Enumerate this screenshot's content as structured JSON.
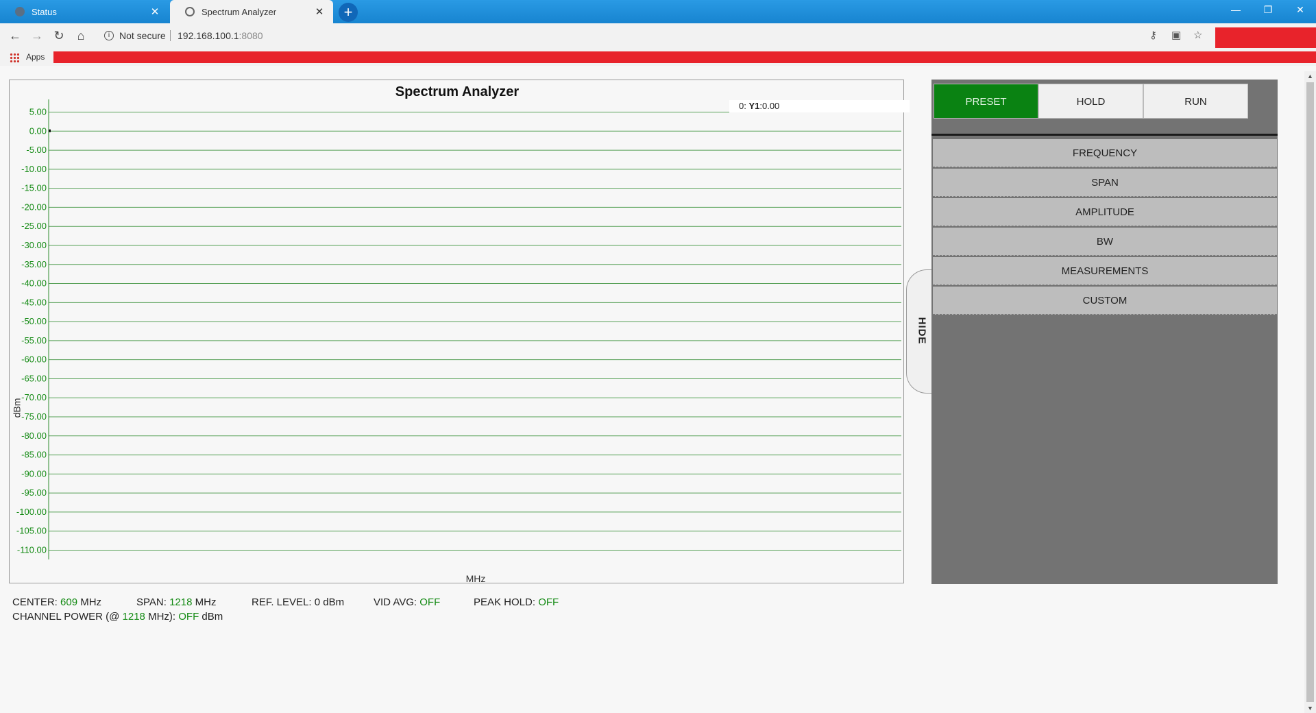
{
  "browser": {
    "tabs": [
      {
        "title": "Status",
        "active": false
      },
      {
        "title": "Spectrum Analyzer",
        "active": true
      }
    ],
    "new_tab_symbol": "+",
    "close_symbol": "✕",
    "window_controls": {
      "minimize": "—",
      "maximize": "❐",
      "close": "✕"
    },
    "security_label": "Not secure",
    "url_host": "192.168.100.1",
    "url_port": ":8080",
    "bookmarks": [
      {
        "label": "Apps",
        "icon": "apps-grid-icon"
      }
    ],
    "accent_red": "#e8232b"
  },
  "chart": {
    "title": "Spectrum Analyzer",
    "readout_index": "0: ",
    "readout_series": "Y1",
    "readout_value": ":0.00",
    "xlabel": "MHz",
    "ylabel": "dBm"
  },
  "chart_data": {
    "type": "line",
    "title": "Spectrum Analyzer",
    "xlabel": "MHz",
    "ylabel": "dBm",
    "ylim": [
      -110,
      5
    ],
    "y_ticks": [
      "5.00",
      "0.00",
      "-5.00",
      "-10.00",
      "-15.00",
      "-20.00",
      "-25.00",
      "-30.00",
      "-35.00",
      "-40.00",
      "-45.00",
      "-50.00",
      "-55.00",
      "-60.00",
      "-65.00",
      "-70.00",
      "-75.00",
      "-80.00",
      "-85.00",
      "-90.00",
      "-95.00",
      "-100.00",
      "-105.00",
      "-110.00"
    ],
    "grid": true,
    "series": [
      {
        "name": "Y1",
        "points": [
          {
            "x": 0,
            "y": 0.0
          }
        ]
      }
    ],
    "grid_color": "#2e8b2e",
    "tick_label_color": "#138a13"
  },
  "hide_tab_label": "HIDE",
  "controls": {
    "preset": "PRESET",
    "hold": "HOLD",
    "run": "RUN",
    "menu": [
      "FREQUENCY",
      "SPAN",
      "AMPLITUDE",
      "BW",
      "MEASUREMENTS",
      "CUSTOM"
    ],
    "preset_color": "#0a8212"
  },
  "status": {
    "center_label": "CENTER: ",
    "center_value": "609",
    "center_unit": " MHz",
    "span_label": "SPAN: ",
    "span_value": "1218",
    "span_unit": " MHz",
    "ref_label": "REF. LEVEL: ",
    "ref_value": "0 dBm",
    "vidavg_label": "VID AVG: ",
    "vidavg_value": "OFF",
    "peakhold_label": "PEAK HOLD: ",
    "peakhold_value": "OFF",
    "chpower_label": "CHANNEL POWER (@ ",
    "chpower_freq": "1218",
    "chpower_mid": " MHz): ",
    "chpower_value": "OFF",
    "chpower_unit": " dBm"
  }
}
